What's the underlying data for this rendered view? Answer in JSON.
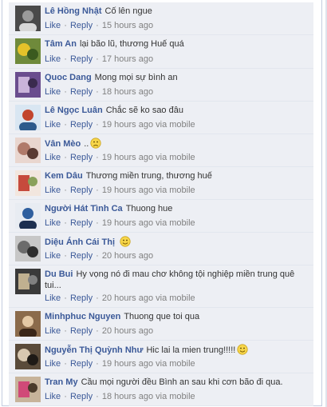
{
  "comments": [
    {
      "name": "Lê Hồng Nhật",
      "text": "Cố lên ngue",
      "like": "Like",
      "reply": "Reply",
      "time": "15 hours ago",
      "via": "",
      "emoji": ""
    },
    {
      "name": "Tâm An",
      "text": "lại bão lũ, thương Huế quá",
      "like": "Like",
      "reply": "Reply",
      "time": "17 hours ago",
      "via": "",
      "emoji": ""
    },
    {
      "name": "Quoc Dang",
      "text": "Mong mọi sự bình an",
      "like": "Like",
      "reply": "Reply",
      "time": "18 hours ago",
      "via": "",
      "emoji": ""
    },
    {
      "name": "Lê Ngọc Luân",
      "text": "Chắc sẽ ko sao đâu",
      "like": "Like",
      "reply": "Reply",
      "time": "19 hours ago",
      "via": "via mobile",
      "emoji": ""
    },
    {
      "name": "Vân Mèo",
      "text": "..",
      "like": "Like",
      "reply": "Reply",
      "time": "19 hours ago",
      "via": "via mobile",
      "emoji": "frown-emoticon"
    },
    {
      "name": "Kem Dâu",
      "text": "Thương miền trung, thương huế",
      "like": "Like",
      "reply": "Reply",
      "time": "19 hours ago",
      "via": "via mobile",
      "emoji": ""
    },
    {
      "name": "Người Hát Tình Ca",
      "text": "Thuong hue",
      "like": "Like",
      "reply": "Reply",
      "time": "19 hours ago",
      "via": "via mobile",
      "emoji": ""
    },
    {
      "name": "Diệu Ánh Cái Thị",
      "text": "",
      "like": "Like",
      "reply": "Reply",
      "time": "20 hours ago",
      "via": "",
      "emoji": "smile-emoticon"
    },
    {
      "name": "Du Bui",
      "text": "Hy vọng nó đi mau chơ không tội nghiệp miền trung quê tui...",
      "like": "Like",
      "reply": "Reply",
      "time": "20 hours ago",
      "via": "via mobile",
      "emoji": ""
    },
    {
      "name": "Minhphuc Nguyen",
      "text": "Thuong que toi qua",
      "like": "Like",
      "reply": "Reply",
      "time": "20 hours ago",
      "via": "",
      "emoji": ""
    },
    {
      "name": "Nguyễn Thị Quỳnh Như",
      "text": "Hic lai la mien trung!!!!!",
      "like": "Like",
      "reply": "Reply",
      "time": "19 hours ago",
      "via": "via mobile",
      "emoji": "smile-emoticon"
    },
    {
      "name": "Tran My",
      "text": "Cầu mọi người đều Bình an sau khi cơn bão đi qua.",
      "like": "Like",
      "reply": "Reply",
      "time": "18 hours ago",
      "via": "via mobile",
      "emoji": ""
    }
  ],
  "colors": {
    "name": "#3b5998",
    "background": "#edeff4",
    "meta": "#808080"
  }
}
